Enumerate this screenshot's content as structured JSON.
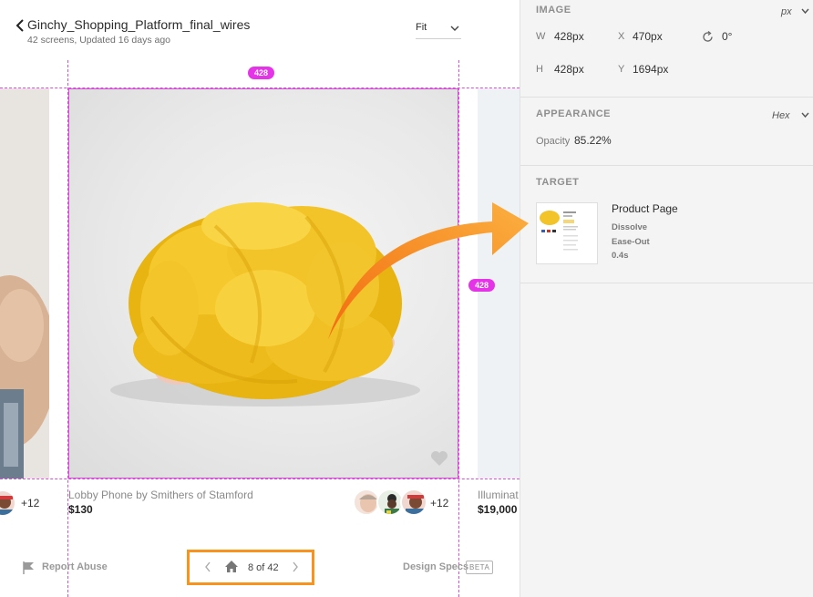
{
  "header": {
    "project_title": "Ginchy_Shopping_Platform_final_wires",
    "project_meta": "42 screens, Updated 16 days ago",
    "zoom_label": "Fit"
  },
  "canvas": {
    "measure_top": "428",
    "measure_right": "428",
    "left_card": {
      "plus_count": "+12"
    },
    "main_card": {
      "title": "Lobby Phone by Smithers of Stamford",
      "price": "$130",
      "plus_count": "+12"
    },
    "right_card": {
      "title": "Illuminat",
      "price": "$19,000"
    }
  },
  "footer": {
    "report_label": "Report Abuse",
    "page_label": "8 of 42",
    "design_specs_label": "Design Specs",
    "beta_label": "BETA"
  },
  "panel": {
    "image": {
      "heading": "IMAGE",
      "unit": "px",
      "w_label": "W",
      "w_value": "428px",
      "x_label": "X",
      "x_value": "470px",
      "rotation_value": "0°",
      "h_label": "H",
      "h_value": "428px",
      "y_label": "Y",
      "y_value": "1694px"
    },
    "appearance": {
      "heading": "APPEARANCE",
      "unit": "Hex",
      "opacity_label": "Opacity",
      "opacity_value": "85.22%"
    },
    "target": {
      "heading": "TARGET",
      "title": "Product Page",
      "transition": "Dissolve",
      "easing": "Ease-Out",
      "duration": "0.4s"
    }
  },
  "colors": {
    "guide": "#d653d8",
    "measure_pill": "#e534e8",
    "highlight": "#f7931e",
    "arrow": "#f7931e",
    "product_yellow": "#f2c42a"
  },
  "icons": [
    "chevron-left-icon",
    "chevron-down-icon",
    "rotate-icon",
    "heart-icon",
    "flag-icon",
    "home-icon",
    "chevron-right-icon"
  ]
}
